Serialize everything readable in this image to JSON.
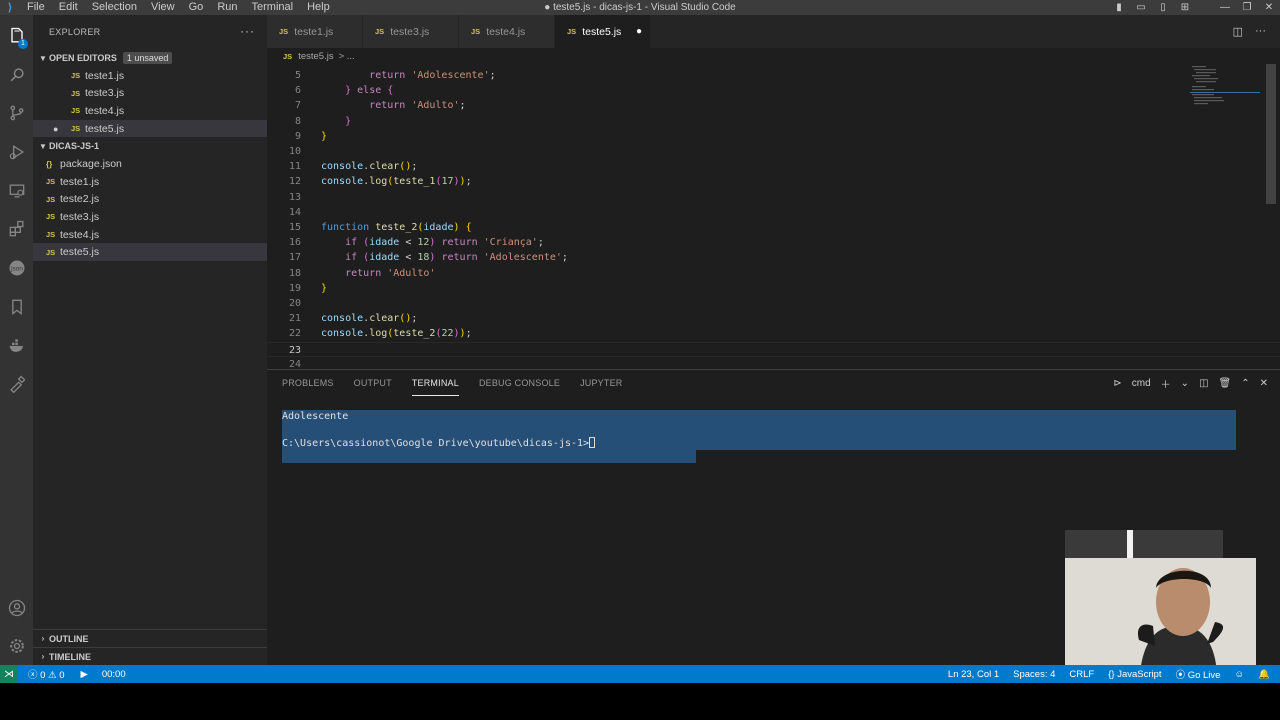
{
  "window": {
    "title": "● teste5.js - dicas-js-1 - Visual Studio Code",
    "menu": [
      "File",
      "Edit",
      "Selection",
      "View",
      "Go",
      "Run",
      "Terminal",
      "Help"
    ]
  },
  "activity_bar": {
    "items": [
      "explorer-icon",
      "search-icon",
      "source-control-icon",
      "run-debug-icon",
      "remote-explorer-icon",
      "extensions-icon",
      "json-icon",
      "bookmarks-icon",
      "docker-icon",
      "testing-icon",
      "account-icon",
      "settings-gear-icon"
    ],
    "explorer_badge": "1"
  },
  "sidebar": {
    "header": "EXPLORER",
    "open_editors": {
      "label": "OPEN EDITORS",
      "badge": "1 unsaved",
      "files": [
        "teste1.js",
        "teste3.js",
        "teste4.js",
        "teste5.js"
      ]
    },
    "folder": {
      "label": "DICAS-JS-1",
      "files": [
        {
          "name": "package.json",
          "type": "json"
        },
        {
          "name": "teste1.js",
          "type": "js"
        },
        {
          "name": "teste2.js",
          "type": "js"
        },
        {
          "name": "teste3.js",
          "type": "js"
        },
        {
          "name": "teste4.js",
          "type": "js"
        },
        {
          "name": "teste5.js",
          "type": "js"
        }
      ]
    },
    "outline": "OUTLINE",
    "timeline": "TIMELINE"
  },
  "tabs": [
    {
      "label": "teste1.js",
      "active": false
    },
    {
      "label": "teste3.js",
      "active": false
    },
    {
      "label": "teste4.js",
      "active": false
    },
    {
      "label": "teste5.js",
      "active": true
    }
  ],
  "file_icon_text": "JS",
  "json_icon_text": "{}",
  "breadcrumb": {
    "file": "teste5.js",
    "rest": "> ..."
  },
  "editor": {
    "lines": [
      {
        "n": "5",
        "text": "        return 'Adolescente';"
      },
      {
        "n": "6",
        "text": "    } else {"
      },
      {
        "n": "7",
        "text": "        return 'Adulto';"
      },
      {
        "n": "8",
        "text": "    }"
      },
      {
        "n": "9",
        "text": "}"
      },
      {
        "n": "10",
        "text": ""
      },
      {
        "n": "11",
        "text": "console.clear();"
      },
      {
        "n": "12",
        "text": "console.log(teste_1(17));"
      },
      {
        "n": "13",
        "text": ""
      },
      {
        "n": "14",
        "text": ""
      },
      {
        "n": "15",
        "text": "function teste_2(idade) {"
      },
      {
        "n": "16",
        "text": "    if (idade < 12) return 'Criança';"
      },
      {
        "n": "17",
        "text": "    if (idade < 18) return 'Adolescente';"
      },
      {
        "n": "18",
        "text": "    return 'Adulto'"
      },
      {
        "n": "19",
        "text": "}"
      },
      {
        "n": "20",
        "text": ""
      },
      {
        "n": "21",
        "text": "console.clear();"
      },
      {
        "n": "22",
        "text": "console.log(teste_2(22));"
      },
      {
        "n": "23",
        "text": ""
      },
      {
        "n": "24",
        "text": ""
      }
    ],
    "current_line": "23"
  },
  "panel": {
    "tabs": [
      "PROBLEMS",
      "OUTPUT",
      "TERMINAL",
      "DEBUG CONSOLE",
      "JUPYTER"
    ],
    "active_tab": "TERMINAL",
    "shell": "cmd",
    "terminal_lines": [
      "Adolescente",
      "",
      "C:\\Users\\cassionot\\Google Drive\\youtube\\dicas-js-1>"
    ]
  },
  "statusbar": {
    "errors": "0",
    "warnings": "0",
    "timer": "00:00",
    "position": "Ln 23, Col 1",
    "spaces": "Spaces: 4",
    "eol": "CRLF",
    "language": "JavaScript",
    "golive": "Go Live"
  },
  "colors": {
    "statusbar": "#007acc",
    "activity_bar": "#333333",
    "sidebar": "#252526",
    "editor": "#1e1e1e",
    "selection": "#264f78"
  }
}
